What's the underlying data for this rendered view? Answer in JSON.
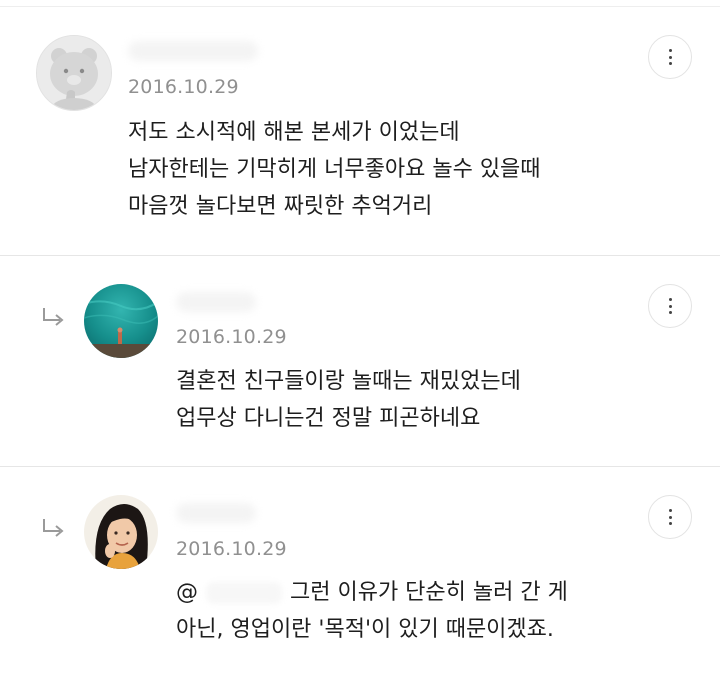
{
  "comments": [
    {
      "date": "2016.10.29",
      "avatar_icon": "bear-character-avatar",
      "is_reply": false,
      "lines": [
        "저도 소시적에 해본 본세가 이었는데",
        "남자한테는 기막히게 너무좋아요 놀수 있을때",
        "마음껏 놀다보면 짜릿한 추억거리"
      ]
    },
    {
      "date": "2016.10.29",
      "avatar_icon": "underwater-photo-avatar",
      "is_reply": true,
      "lines": [
        "결혼전 친구들이랑 놀때는 재밌었는데",
        "업무상 다니는건 정말 피곤하네요"
      ]
    },
    {
      "date": "2016.10.29",
      "avatar_icon": "person-photo-avatar",
      "is_reply": true,
      "mention_symbol": "@",
      "lines": [
        "그런 이유가 단순히 놀러 간 게",
        "아닌, 영업이란 '목적'이 있기 때문이겠죠."
      ]
    }
  ],
  "icons": {
    "reply": "reply-arrow-icon",
    "more": "more-vertical-icon"
  },
  "colors": {
    "date": "#909090",
    "text": "#1e1e1e",
    "divider": "#e6e6e6"
  }
}
